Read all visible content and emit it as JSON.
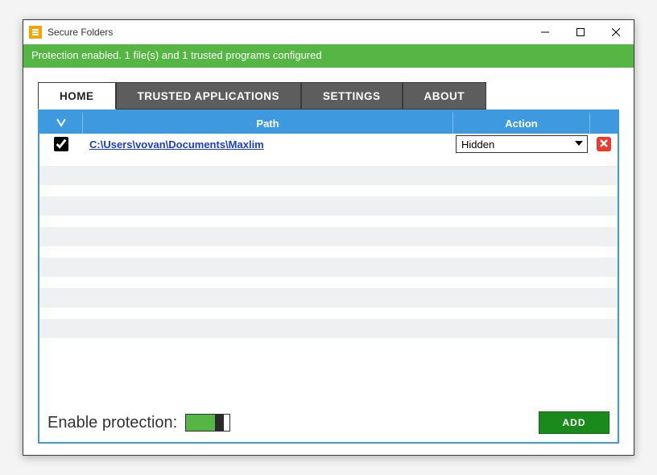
{
  "window": {
    "title": "Secure Folders"
  },
  "status": {
    "text": "Protection enabled. 1 file(s) and 1 trusted programs configured"
  },
  "tabs": {
    "items": [
      {
        "label": "HOME",
        "active": true
      },
      {
        "label": "TRUSTED APPLICATIONS",
        "active": false
      },
      {
        "label": "SETTINGS",
        "active": false
      },
      {
        "label": "ABOUT",
        "active": false
      }
    ]
  },
  "table": {
    "headers": {
      "path": "Path",
      "action": "Action"
    },
    "rows": [
      {
        "checked": true,
        "path": "C:\\Users\\vovan\\Documents\\Maxlim",
        "action": "Hidden"
      }
    ],
    "actionOptions": [
      "Hidden"
    ]
  },
  "footer": {
    "enableLabel": "Enable protection:",
    "enabled": true,
    "addLabel": "ADD"
  },
  "colors": {
    "accentGreen": "#55b643",
    "accentBlue": "#3f99df",
    "tabDark": "#5d5d5d",
    "addGreen": "#1a8a1d",
    "deleteRed": "#eb3b2f"
  }
}
